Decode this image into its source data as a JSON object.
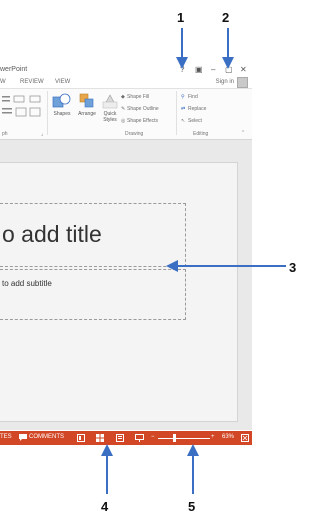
{
  "app": {
    "title_fragment": "werPoint"
  },
  "window_controls": {
    "help": "?",
    "ribbon_display": "▣",
    "minimize": "–",
    "restore": "▢",
    "close": "✕"
  },
  "tabs": [
    {
      "label": "W"
    },
    {
      "label": "REVIEW"
    },
    {
      "label": "VIEW"
    }
  ],
  "account": {
    "sign_in": "Sign in"
  },
  "ribbon": {
    "groups": {
      "paragraph_fragment": "ph",
      "drawing": "Drawing",
      "editing": "Editing"
    },
    "buttons": {
      "shapes": "Shapes",
      "arrange": "Arrange",
      "quick_styles": [
        "Quick",
        "Styles"
      ],
      "shape_fill": "Shape Fill",
      "shape_outline": "Shape Outline",
      "shape_effects": "Shape Effects",
      "find": "Find",
      "replace": "Replace",
      "select": "Select"
    }
  },
  "slide": {
    "title_placeholder": "o add title",
    "subtitle_placeholder": "to add subtitle"
  },
  "statusbar": {
    "notes_fragment": "TES",
    "comments": "COMMENTS",
    "zoom_percent": "63%"
  },
  "callouts": [
    "1",
    "2",
    "3",
    "4",
    "5"
  ],
  "colors": {
    "accent": "#d24726",
    "arrow": "#3a6fc4"
  }
}
